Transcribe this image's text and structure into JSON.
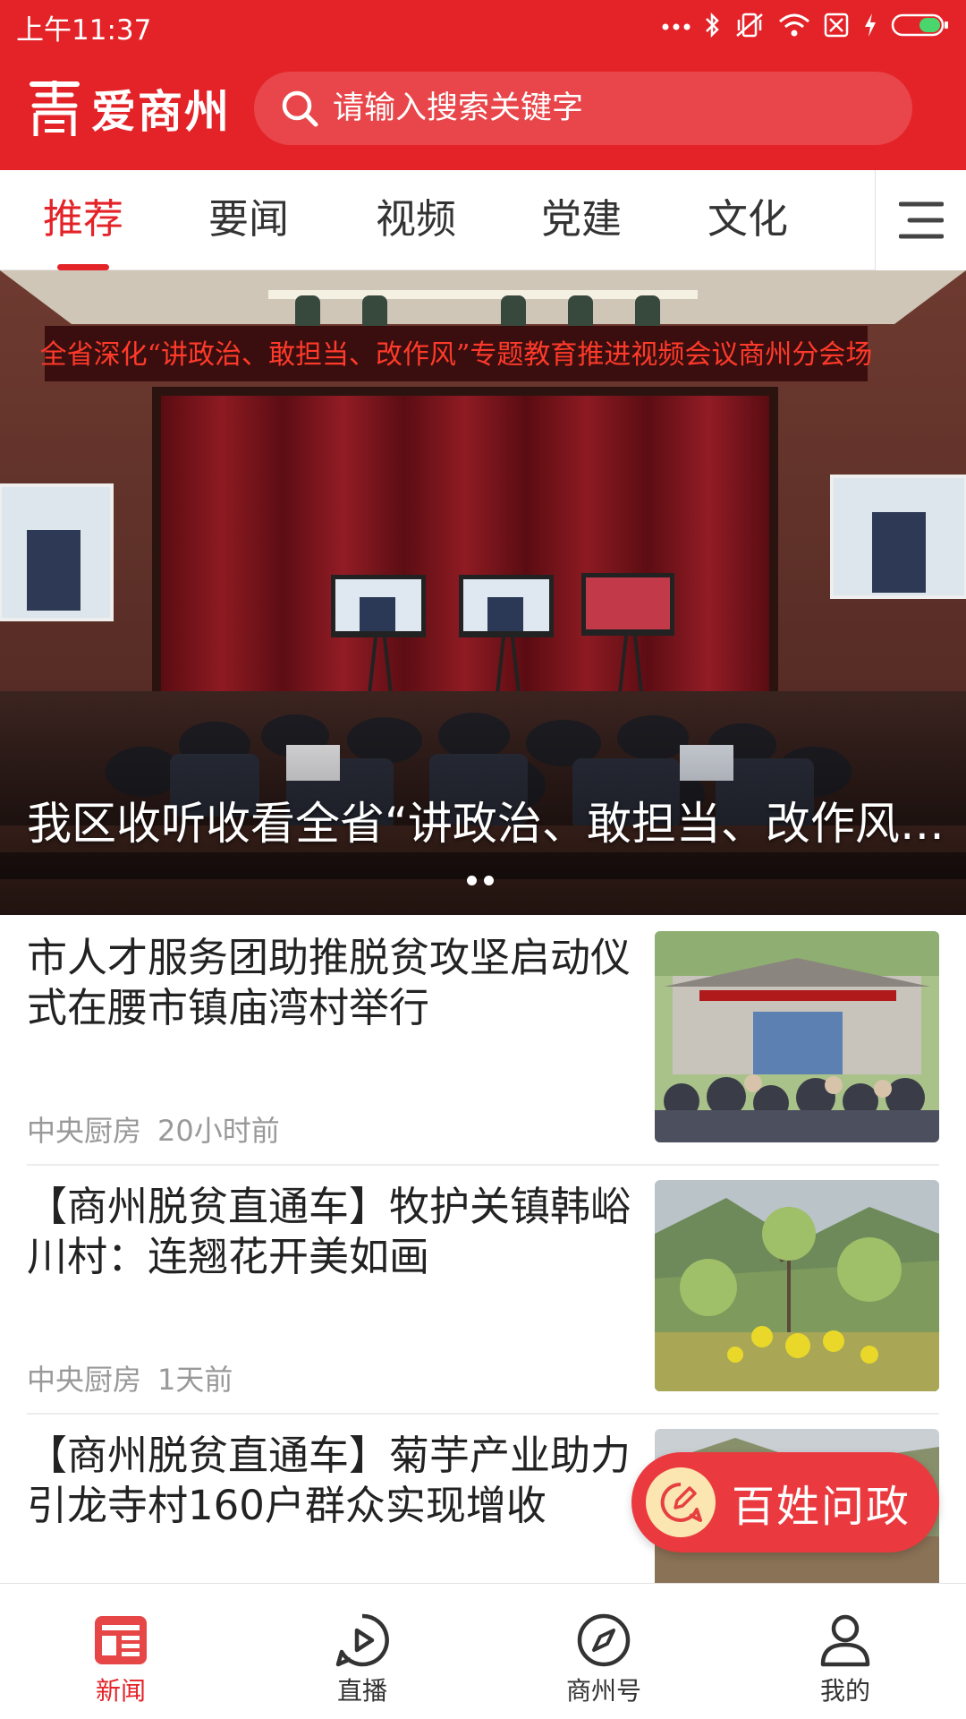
{
  "status_bar": {
    "time": "上午11:37",
    "icons": [
      "more-dots-icon",
      "bluetooth-icon",
      "vibrate-icon",
      "wifi-icon",
      "no-sim-icon",
      "charging-icon",
      "battery-icon"
    ]
  },
  "header": {
    "app_name": "爱商州",
    "search_placeholder": "请输入搜索关键字",
    "brand_color": "#e42328"
  },
  "tabs": {
    "items": [
      {
        "label": "推荐",
        "active": true
      },
      {
        "label": "要闻",
        "active": false
      },
      {
        "label": "视频",
        "active": false
      },
      {
        "label": "党建",
        "active": false
      },
      {
        "label": "文化",
        "active": false
      }
    ],
    "menu_icon": "hamburger-menu-icon"
  },
  "hero": {
    "banner_text": "全省深化“讲政治、敢担当、改作风”专题教育推进视频会议商州分会场",
    "title": "我区收听收看全省“讲政治、敢担当、改作风”专题教育推进视频会议",
    "page_count": 2
  },
  "news": [
    {
      "title": "市人才服务团助推脱贫攻坚启动仪式在腰市镇庙湾村举行",
      "source": "中央厨房",
      "time": "20小时前"
    },
    {
      "title": "【商州脱贫直通车】牧护关镇韩峪川村：连翘花开美如画",
      "source": "中央厨房",
      "time": "1天前"
    },
    {
      "title": "【商州脱贫直通车】菊芋产业助力引龙寺村160户群众实现增收",
      "source": "",
      "time": ""
    }
  ],
  "fab": {
    "label": "百姓问政",
    "icon": "edit-chat-icon"
  },
  "bottom_nav": {
    "items": [
      {
        "label": "新闻",
        "icon": "news-icon",
        "active": true
      },
      {
        "label": "直播",
        "icon": "play-icon",
        "active": false
      },
      {
        "label": "商州号",
        "icon": "compass-icon",
        "active": false
      },
      {
        "label": "我的",
        "icon": "user-icon",
        "active": false
      }
    ]
  }
}
